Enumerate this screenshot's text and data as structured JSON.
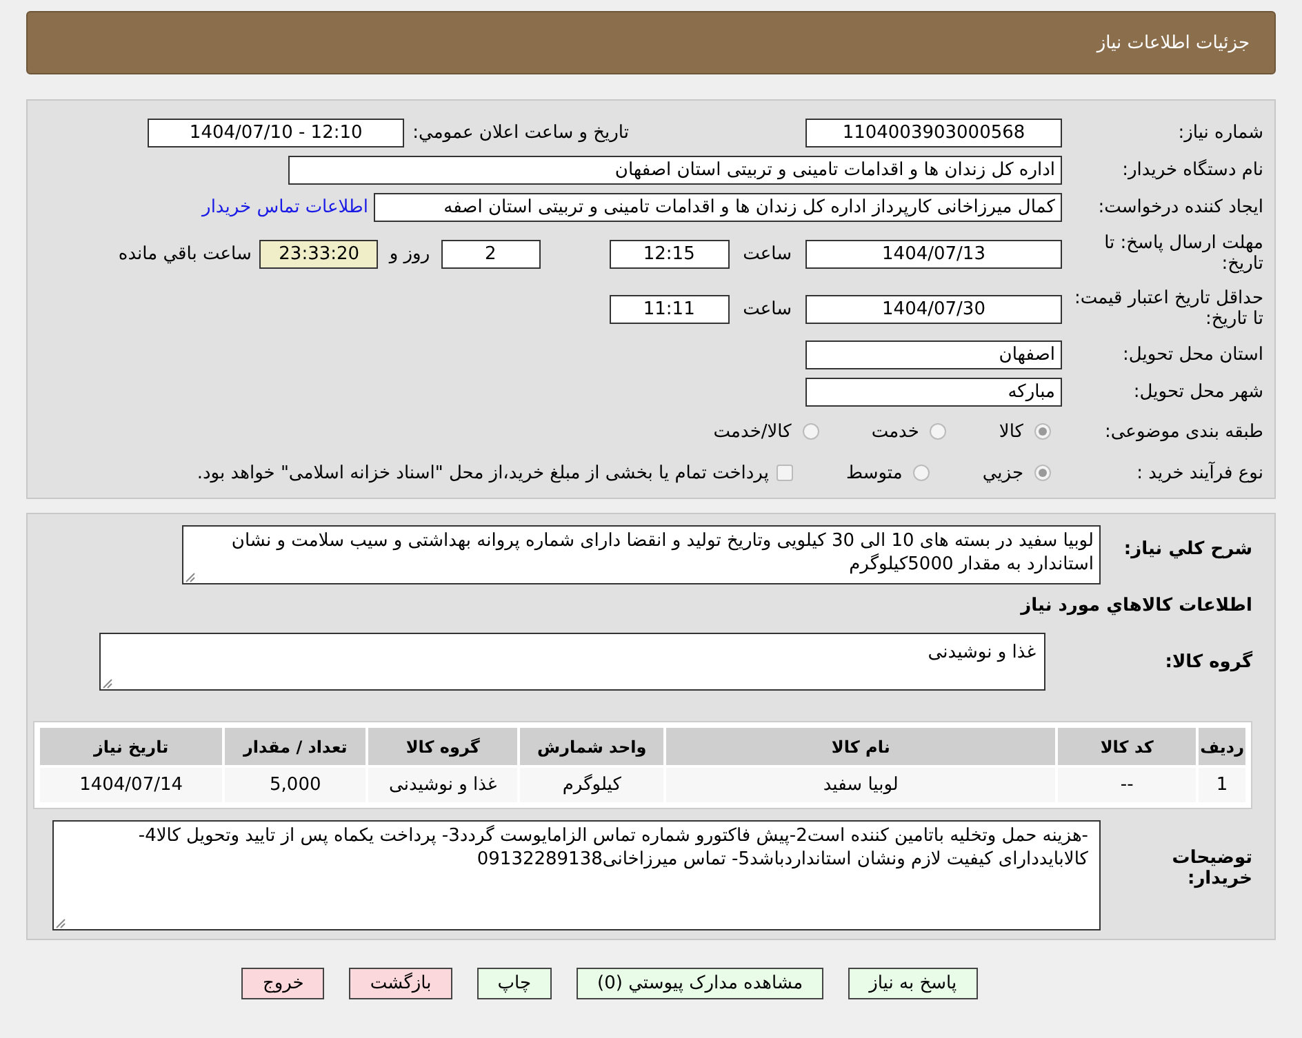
{
  "header": {
    "title": "جزئیات اطلاعات نیاز"
  },
  "need_number": {
    "label": "شماره نیاز:",
    "value": "1104003903000568"
  },
  "announce": {
    "label": "تاریخ و ساعت اعلان عمومي:",
    "value": "1404/07/10 - 12:10"
  },
  "buyer_org": {
    "label": "نام دستگاه خریدار:",
    "value": "اداره کل زندان ها و اقدامات تامینی و تربیتی استان اصفهان"
  },
  "requester": {
    "label": "ایجاد کننده درخواست:",
    "value": "کمال میرزاخانی کارپرداز اداره کل زندان ها و اقدامات تامینی و تربیتی استان اصفه",
    "link": "اطلاعات تماس خریدار"
  },
  "deadline": {
    "label": "مهلت ارسال پاسخ: تا تاریخ:",
    "date": "1404/07/13",
    "time_label": "ساعت",
    "time": "12:15",
    "days": "2",
    "days_label": "روز و",
    "remaining": "23:33:20",
    "remaining_label": "ساعت باقي مانده"
  },
  "validity": {
    "label": "حداقل تاریخ اعتبار قیمت: تا تاریخ:",
    "date": "1404/07/30",
    "time_label": "ساعت",
    "time": "11:11"
  },
  "province": {
    "label": "استان محل تحویل:",
    "value": "اصفهان"
  },
  "city": {
    "label": "شهر محل تحویل:",
    "value": "مبارکه"
  },
  "category": {
    "label": "طبقه بندی موضوعی:",
    "options": [
      {
        "label": "کالا",
        "selected": true
      },
      {
        "label": "خدمت",
        "selected": false
      },
      {
        "label": "کالا/خدمت",
        "selected": false
      }
    ]
  },
  "process": {
    "label": "نوع فرآیند خرید :",
    "options": [
      {
        "label": "جزيي",
        "selected": true
      },
      {
        "label": "متوسط",
        "selected": false
      }
    ],
    "checkbox": {
      "label": "پرداخت تمام یا بخشی از مبلغ خرید،از محل \"اسناد خزانه اسلامی\" خواهد بود.",
      "checked": false
    }
  },
  "description": {
    "label": "شرح کلي نیاز:",
    "value": "لوبیا سفید در بسته های 10 الی 30 کیلویی وتاریخ تولید و انقضا  دارای شماره پروانه بهداشتی و سیب سلامت و نشان استاندارد به مقدار 5000کیلوگرم"
  },
  "goods_heading": "اطلاعات کالاهاي مورد نیاز",
  "goods_group": {
    "label": "گروه کالا:",
    "value": "غذا و نوشیدنی"
  },
  "table": {
    "columns": [
      "ردیف",
      "کد کالا",
      "نام کالا",
      "واحد شمارش",
      "گروه کالا",
      "تعداد / مقدار",
      "تاریخ نیاز"
    ],
    "rows": [
      [
        "1",
        "--",
        "لوبیا سفید",
        "کیلوگرم",
        "غذا و نوشیدنی",
        "5,000",
        "1404/07/14"
      ]
    ]
  },
  "buyer_notes": {
    "label": "توضیحات خریدار:",
    "value": "-هزینه حمل وتخلیه باتامین کننده است2-پیش فاکتورو شماره تماس الزامایوست گردد3- پرداخت یکماه  پس از تایید وتحویل کالا4-کالابایددارای کیفیت لازم ونشان استانداردباشد5- تماس میرزاخانی09132289138"
  },
  "buttons": [
    {
      "label": "پاسخ به نیاز",
      "kind": "normal"
    },
    {
      "label": "مشاهده مدارک پیوستي (0)",
      "kind": "normal"
    },
    {
      "label": "چاپ",
      "kind": "normal"
    },
    {
      "label": "بازگشت",
      "kind": "danger"
    },
    {
      "label": "خروج",
      "kind": "danger"
    }
  ]
}
